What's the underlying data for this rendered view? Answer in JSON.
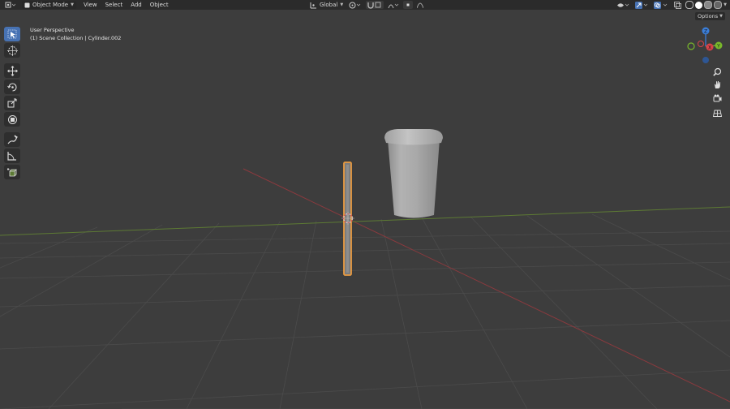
{
  "header": {
    "mode_label": "Object Mode",
    "menus": [
      "View",
      "Select",
      "Add",
      "Object"
    ],
    "orientation_label": "Global"
  },
  "viewport": {
    "perspective_label": "User Perspective",
    "collection_label": "(1) Scene Collection | Cylinder.002",
    "options_label": "Options"
  },
  "gizmo": {
    "z_label": "Z",
    "x_label": "X",
    "y_label": "Y"
  },
  "colors": {
    "x_axis": "#d8434a",
    "y_axis": "#79b82b",
    "z_axis": "#3b7ed8",
    "selection": "#e89a40",
    "active_tool": "#4772b3"
  },
  "icons": {
    "toolbar": [
      "select-box-icon",
      "cursor-icon",
      "move-icon",
      "rotate-icon",
      "scale-icon",
      "transform-icon",
      "annotate-icon",
      "measure-icon",
      "add-cube-icon"
    ],
    "nav": [
      "zoom-icon",
      "hand-icon",
      "camera-icon",
      "grid-icon"
    ]
  }
}
